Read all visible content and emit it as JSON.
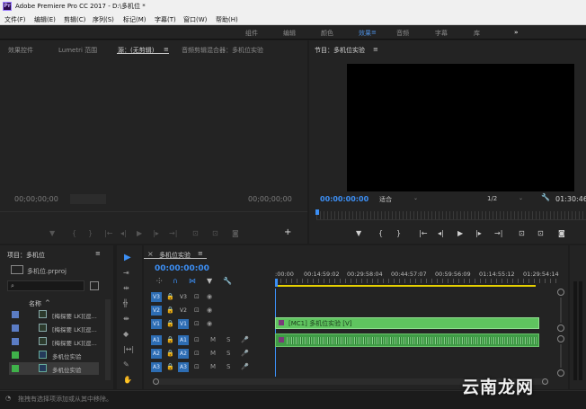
{
  "title_bar": {
    "app_icon": "Pr",
    "title": "Adobe Premiere Pro CC 2017 - D:\\多机位 *"
  },
  "menu": [
    "文件(F)",
    "编辑(E)",
    "剪辑(C)",
    "序列(S)",
    "标记(M)",
    "字幕(T)",
    "窗口(W)",
    "帮助(H)"
  ],
  "workspaces": {
    "items": [
      "组件",
      "编辑",
      "颜色",
      "效果",
      "音频",
      "字幕",
      "库"
    ],
    "active": "效果",
    "overflow": "»"
  },
  "source_panel": {
    "tabs": [
      "效果控件",
      "Lumetri 范围",
      "源：(无剪辑)",
      "音频剪辑混合器：多机位实验"
    ],
    "active_tab": "源：(无剪辑)",
    "timecode_left": "00;00;00;00",
    "timecode_right": "00;00;00;00"
  },
  "program_panel": {
    "title": "节目：多机位实验",
    "timecode": "00:00:00:00",
    "fit": "适合",
    "resolution": "1/2",
    "duration": "01:30:46"
  },
  "project_panel": {
    "title": "项目：多机位",
    "file": "多机位.prproj",
    "column_name": "名称",
    "items": [
      {
        "name": "[梅探要 LK][逗...",
        "color": "#5b7cc4",
        "type": "clip"
      },
      {
        "name": "[梅探要 LK][逗...",
        "color": "#5b7cc4",
        "type": "clip"
      },
      {
        "name": "[梅探要 LK][逗...",
        "color": "#5b7cc4",
        "type": "clip"
      },
      {
        "name": "多机位实验",
        "color": "#3fb24a",
        "type": "sequence"
      },
      {
        "name": "多机位实验",
        "color": "#3fb24a",
        "type": "sequence",
        "selected": true
      }
    ]
  },
  "timeline": {
    "tab": "多机位实验",
    "timecode": "00:00:00:00",
    "ruler": [
      ":00:00",
      "00:14:59:02",
      "00:29:58:04",
      "00:44:57:07",
      "00:59:56:09",
      "01:14:55:12",
      "01:29:54:14"
    ],
    "video_tracks": [
      {
        "src": "V3",
        "name": "V3",
        "src_on": false
      },
      {
        "src": "V2",
        "name": "V2",
        "src_on": false
      },
      {
        "src": "V1",
        "name": "V1",
        "src_on": true
      }
    ],
    "audio_tracks": [
      {
        "src": "A1",
        "name": "A1"
      },
      {
        "src": "A2",
        "name": "A2"
      },
      {
        "src": "A3",
        "name": "A3"
      }
    ],
    "mute_label": "M",
    "solo_label": "S",
    "video_clip": "[MC1] 多机位实验 [V]",
    "clip_colors": {
      "video": "#5fc45f",
      "audio": "#3f9c46"
    }
  },
  "status_bar": {
    "hint": "拖拽有选择项添加或从其中移除。"
  },
  "watermark": "云南龙网"
}
